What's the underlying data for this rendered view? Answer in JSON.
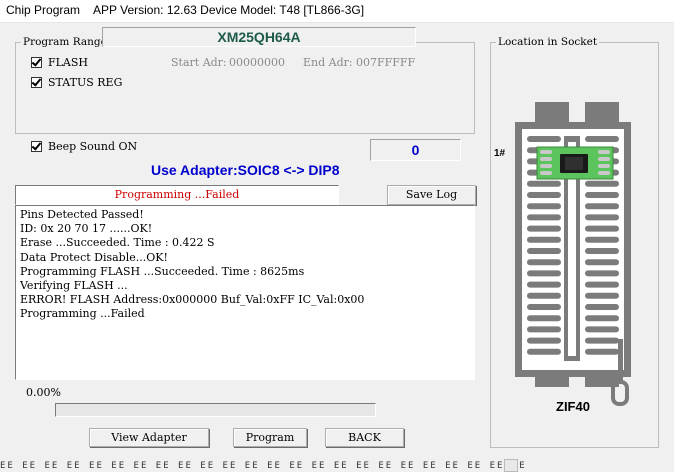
{
  "window": {
    "title": "Chip Program",
    "app_info": "APP Version: 12.63 Device Model: T48 [TL866-3G]"
  },
  "program_range": {
    "legend": "Program Range",
    "chip_name": "XM25QH64A",
    "flash_label": "FLASH",
    "flash_checked": true,
    "status_reg_label": "STATUS REG",
    "status_reg_checked": true,
    "start_adr_label": "Start Adr:",
    "start_adr_value": "00000000",
    "end_adr_label": "End Adr:",
    "end_adr_value": "007FFFFF"
  },
  "beep": {
    "label": "Beep Sound ON",
    "checked": true
  },
  "counter": "0",
  "adapter_text": "Use Adapter:SOIC8 <-> DIP8",
  "status_text": "Programming  ...Failed",
  "save_log_label": "Save Log",
  "log_lines": [
    "Pins Detected Passed!",
    "ID: 0x 20 70 17 ......OK!",
    "Erase  ...Succeeded. Time : 0.422 S",
    "Data Protect Disable...OK!",
    "Programming FLASH ...Succeeded. Time : 8625ms",
    "Verifying FLASH ...",
    "ERROR!   FLASH Address:0x000000    Buf_Val:0xFF    IC_Val:0x00",
    "Programming  ...Failed"
  ],
  "progress": {
    "label": "0.00%",
    "value": 0
  },
  "buttons": {
    "view_adapter": "View Adapter",
    "program": "Program",
    "back": "BACK"
  },
  "socket": {
    "legend": "Location in Socket",
    "pin1_marker": "1#",
    "socket_label": "ZIF40"
  },
  "colors": {
    "chip_name": "#1e5a4a",
    "adapter_text": "#0000cc",
    "counter": "#0000cc",
    "status_failed": "#cc0000",
    "pcb": "#5cc45c"
  }
}
